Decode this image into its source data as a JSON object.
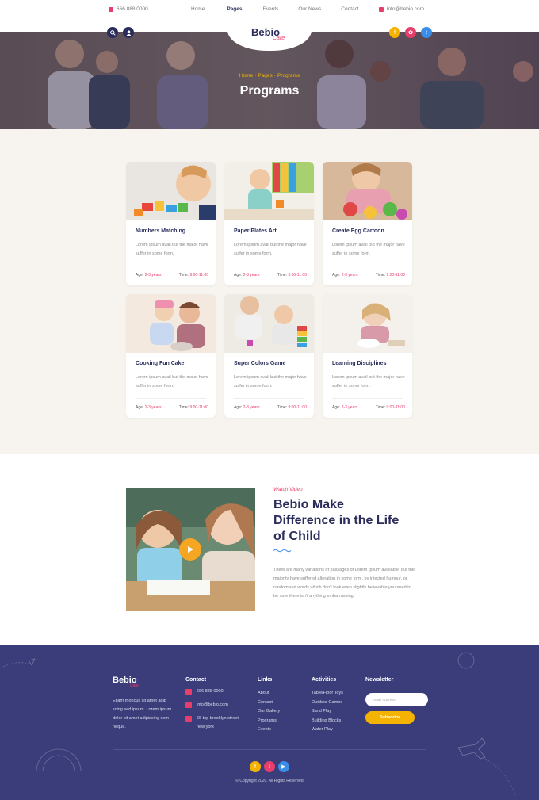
{
  "topbar": {
    "phone": "666 888 0000",
    "email": "info@bebio.com",
    "nav": [
      {
        "label": "Home"
      },
      {
        "label": "Pages"
      },
      {
        "label": "Events"
      },
      {
        "label": "Our News"
      },
      {
        "label": "Contact"
      }
    ],
    "active_nav": "Pages"
  },
  "brand": {
    "name": "Bebio",
    "tagline": "Care"
  },
  "hero": {
    "breadcrumb": [
      "Home",
      "Pages",
      "Programs"
    ],
    "title": "Programs"
  },
  "social": {
    "facebook": "f",
    "instagram": "✿",
    "twitter": "t",
    "youtube": "▶"
  },
  "colors": {
    "navy": "#2a2d5b",
    "pink": "#e83e6c",
    "yellow": "#f5b301",
    "orange": "#f5a623",
    "cream": "#f7f4ef",
    "footer": "#3a3d7a"
  },
  "programs": [
    {
      "title": "Numbers Matching",
      "desc": "Lorem ipsum avail but the major have suffer in some form.",
      "age_label": "Age:",
      "age": "2-3 years",
      "time_label": "Time:",
      "time": "9:00-11:00"
    },
    {
      "title": "Paper Plates Art",
      "desc": "Lorem ipsum avail but the major have suffer in some form.",
      "age_label": "Age:",
      "age": "2-3 years",
      "time_label": "Time:",
      "time": "9:00-11:00"
    },
    {
      "title": "Create Egg Cartoon",
      "desc": "Lorem ipsum avail but the major have suffer in some form.",
      "age_label": "Age:",
      "age": "2-3 years",
      "time_label": "Time:",
      "time": "9:00-11:00"
    },
    {
      "title": "Cooking Fun Cake",
      "desc": "Lorem ipsum avail but the major have suffer in some form.",
      "age_label": "Age:",
      "age": "2-3 years",
      "time_label": "Time:",
      "time": "9:00-11:00"
    },
    {
      "title": "Super Colors Game",
      "desc": "Lorem ipsum avail but the major have suffer in some form.",
      "age_label": "Age:",
      "age": "2-3 years",
      "time_label": "Time:",
      "time": "9:00-11:00"
    },
    {
      "title": "Learning Disciplines",
      "desc": "Lorem ipsum avail but the major have suffer in some form.",
      "age_label": "Age:",
      "age": "2-3 years",
      "time_label": "Time:",
      "time": "9:00-11:00"
    }
  ],
  "video": {
    "kicker": "Watch Video",
    "heading": "Bebio Make Difference in the Life of Child",
    "text": "There are many variations of passages of Lorem Ipsum available, but the majority have suffered alteration in some form, by injected humour, or randomised words which don't look even slightly believable you need to be sure there isn't anything embarrassing."
  },
  "footer": {
    "about": "Etiam rhoncus sit amet adip scing sed ipsum. Lorem ipsum dolor sit amet adipiscing sem neque.",
    "contact_heading": "Contact",
    "contact": {
      "phone": "666 888 0000",
      "email": "info@bebio.com",
      "address": "66 top brooklyn street new york"
    },
    "links_heading": "Links",
    "links": [
      "About",
      "Contact",
      "Our Gallery",
      "Programs",
      "Events"
    ],
    "activities_heading": "Activities",
    "activities": [
      "Table/Floor Toys",
      "Outdoor Games",
      "Sand Play",
      "Building Blocks",
      "Water Play"
    ],
    "newsletter_heading": "Newsletter",
    "newsletter_placeholder": "Email Address",
    "subscribe_label": "Subscribe",
    "copyright": "© Copyright 2020. All Rights Reserved"
  }
}
